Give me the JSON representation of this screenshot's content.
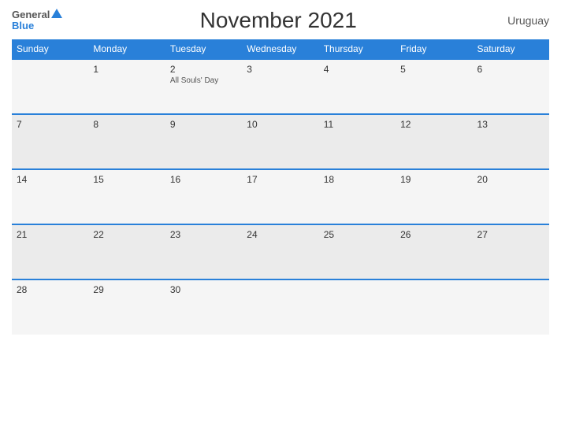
{
  "header": {
    "logo_general": "General",
    "logo_blue": "Blue",
    "title": "November 2021",
    "country": "Uruguay"
  },
  "weekdays": [
    "Sunday",
    "Monday",
    "Tuesday",
    "Wednesday",
    "Thursday",
    "Friday",
    "Saturday"
  ],
  "weeks": [
    [
      {
        "day": "",
        "event": ""
      },
      {
        "day": "1",
        "event": ""
      },
      {
        "day": "2",
        "event": "All Souls' Day"
      },
      {
        "day": "3",
        "event": ""
      },
      {
        "day": "4",
        "event": ""
      },
      {
        "day": "5",
        "event": ""
      },
      {
        "day": "6",
        "event": ""
      }
    ],
    [
      {
        "day": "7",
        "event": ""
      },
      {
        "day": "8",
        "event": ""
      },
      {
        "day": "9",
        "event": ""
      },
      {
        "day": "10",
        "event": ""
      },
      {
        "day": "11",
        "event": ""
      },
      {
        "day": "12",
        "event": ""
      },
      {
        "day": "13",
        "event": ""
      }
    ],
    [
      {
        "day": "14",
        "event": ""
      },
      {
        "day": "15",
        "event": ""
      },
      {
        "day": "16",
        "event": ""
      },
      {
        "day": "17",
        "event": ""
      },
      {
        "day": "18",
        "event": ""
      },
      {
        "day": "19",
        "event": ""
      },
      {
        "day": "20",
        "event": ""
      }
    ],
    [
      {
        "day": "21",
        "event": ""
      },
      {
        "day": "22",
        "event": ""
      },
      {
        "day": "23",
        "event": ""
      },
      {
        "day": "24",
        "event": ""
      },
      {
        "day": "25",
        "event": ""
      },
      {
        "day": "26",
        "event": ""
      },
      {
        "day": "27",
        "event": ""
      }
    ],
    [
      {
        "day": "28",
        "event": ""
      },
      {
        "day": "29",
        "event": ""
      },
      {
        "day": "30",
        "event": ""
      },
      {
        "day": "",
        "event": ""
      },
      {
        "day": "",
        "event": ""
      },
      {
        "day": "",
        "event": ""
      },
      {
        "day": "",
        "event": ""
      }
    ]
  ]
}
